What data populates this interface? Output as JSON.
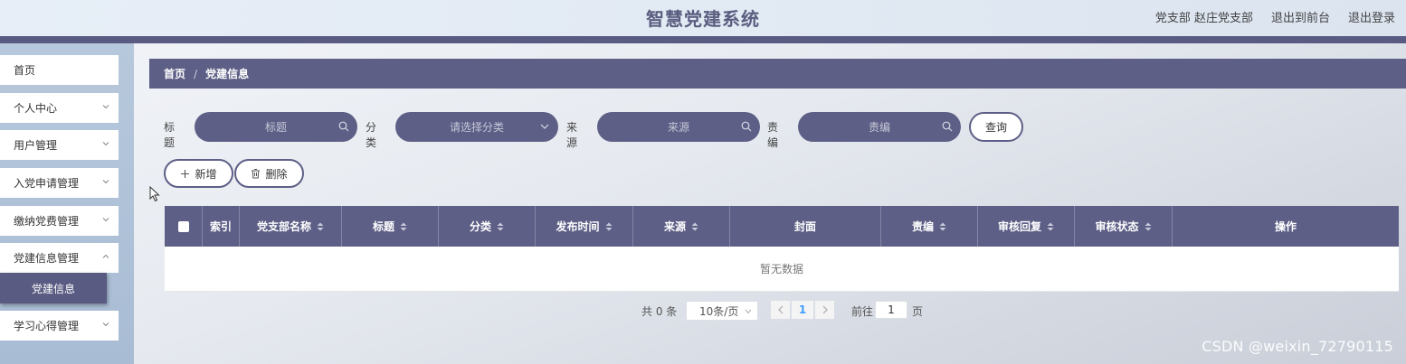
{
  "header": {
    "title": "智慧党建系统",
    "user": "党支部 赵庄党支部",
    "back_front": "退出到前台",
    "logout": "退出登录"
  },
  "sidebar": {
    "items": [
      {
        "label": "首页"
      },
      {
        "label": "个人中心"
      },
      {
        "label": "用户管理"
      },
      {
        "label": "入党申请管理"
      },
      {
        "label": "缴纳党费管理"
      },
      {
        "label": "党建信息管理"
      },
      {
        "label": "学习心得管理"
      }
    ],
    "active_sub": "党建信息"
  },
  "breadcrumb": {
    "home": "首页",
    "current": "党建信息"
  },
  "search": {
    "title_label": "标题",
    "title_placeholder": "标题",
    "category_label": "分类",
    "category_placeholder": "请选择分类",
    "source_label": "来源",
    "source_placeholder": "来源",
    "editor_label": "责编",
    "editor_placeholder": "责编",
    "query_button": "查询"
  },
  "actions": {
    "add": "新增",
    "delete": "删除"
  },
  "table": {
    "columns": [
      "索引",
      "党支部名称",
      "标题",
      "分类",
      "发布时间",
      "来源",
      "封面",
      "责编",
      "审核回复",
      "审核状态",
      "操作"
    ],
    "empty_text": "暂无数据"
  },
  "pagination": {
    "total": "共 0 条",
    "page_size": "10条/页",
    "current_page": "1",
    "goto_label": "前往",
    "goto_value": "1",
    "page_suffix": "页"
  },
  "watermark": "CSDN @weixin_72790115",
  "colors": {
    "primary": "#5d5f86",
    "sidebar": "#b7c8dc",
    "header_bg": "#e5edf6"
  }
}
